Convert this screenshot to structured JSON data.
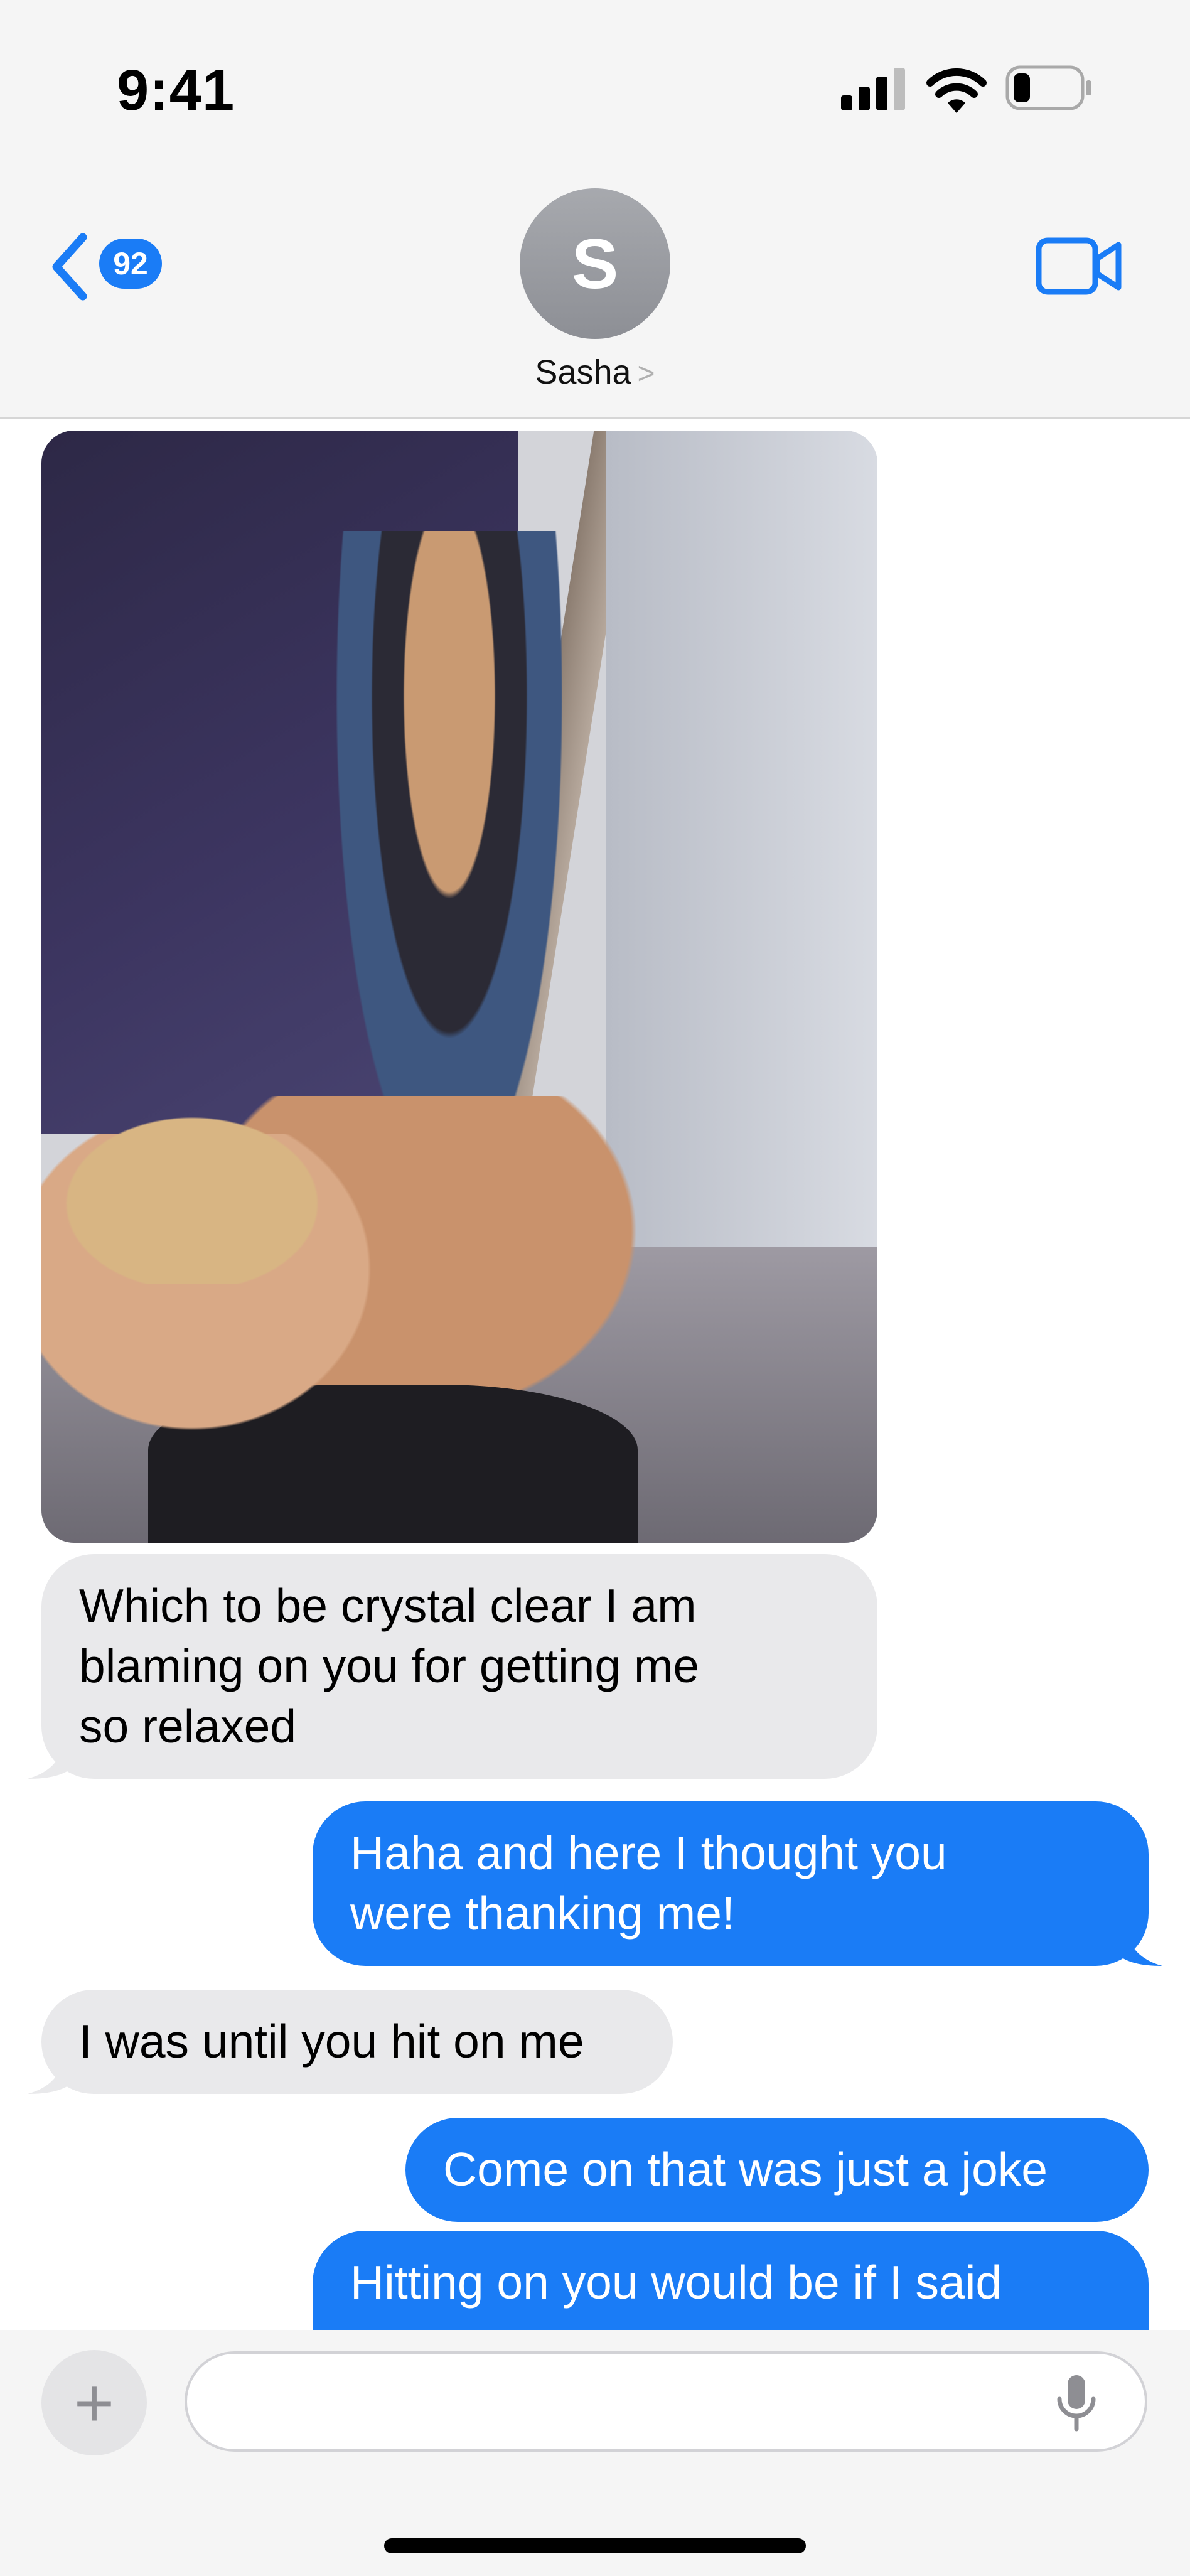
{
  "status_bar": {
    "time": "9:41",
    "icons": [
      "cellular-signal-icon",
      "wifi-icon",
      "battery-icon"
    ]
  },
  "header": {
    "back_badge": "92",
    "avatar_initial": "S",
    "contact_name": "Sasha",
    "contact_chevron": ">",
    "video_icon": "video-camera-icon"
  },
  "thread": {
    "photo": {
      "from": "incoming",
      "icon": "photo-message"
    },
    "messages": [
      {
        "from": "incoming",
        "text": "Which to be crystal clear I am\nblaming on you for getting me\nso relaxed"
      },
      {
        "from": "outgoing",
        "text": "Haha and here I thought you\nwere thanking me!"
      },
      {
        "from": "incoming",
        "text": "I was until you hit on me"
      },
      {
        "from": "outgoing",
        "text": "Come on that was just a joke"
      },
      {
        "from": "outgoing",
        "text": "Hitting on you would be if I said"
      }
    ]
  },
  "composer": {
    "plus_label": "+",
    "placeholder": "",
    "mic_icon": "microphone-icon"
  },
  "colors": {
    "outgoing_bubble": "#1a7cf6",
    "incoming_bubble": "#e9e9eb",
    "header_bg": "#f5f5f5"
  }
}
